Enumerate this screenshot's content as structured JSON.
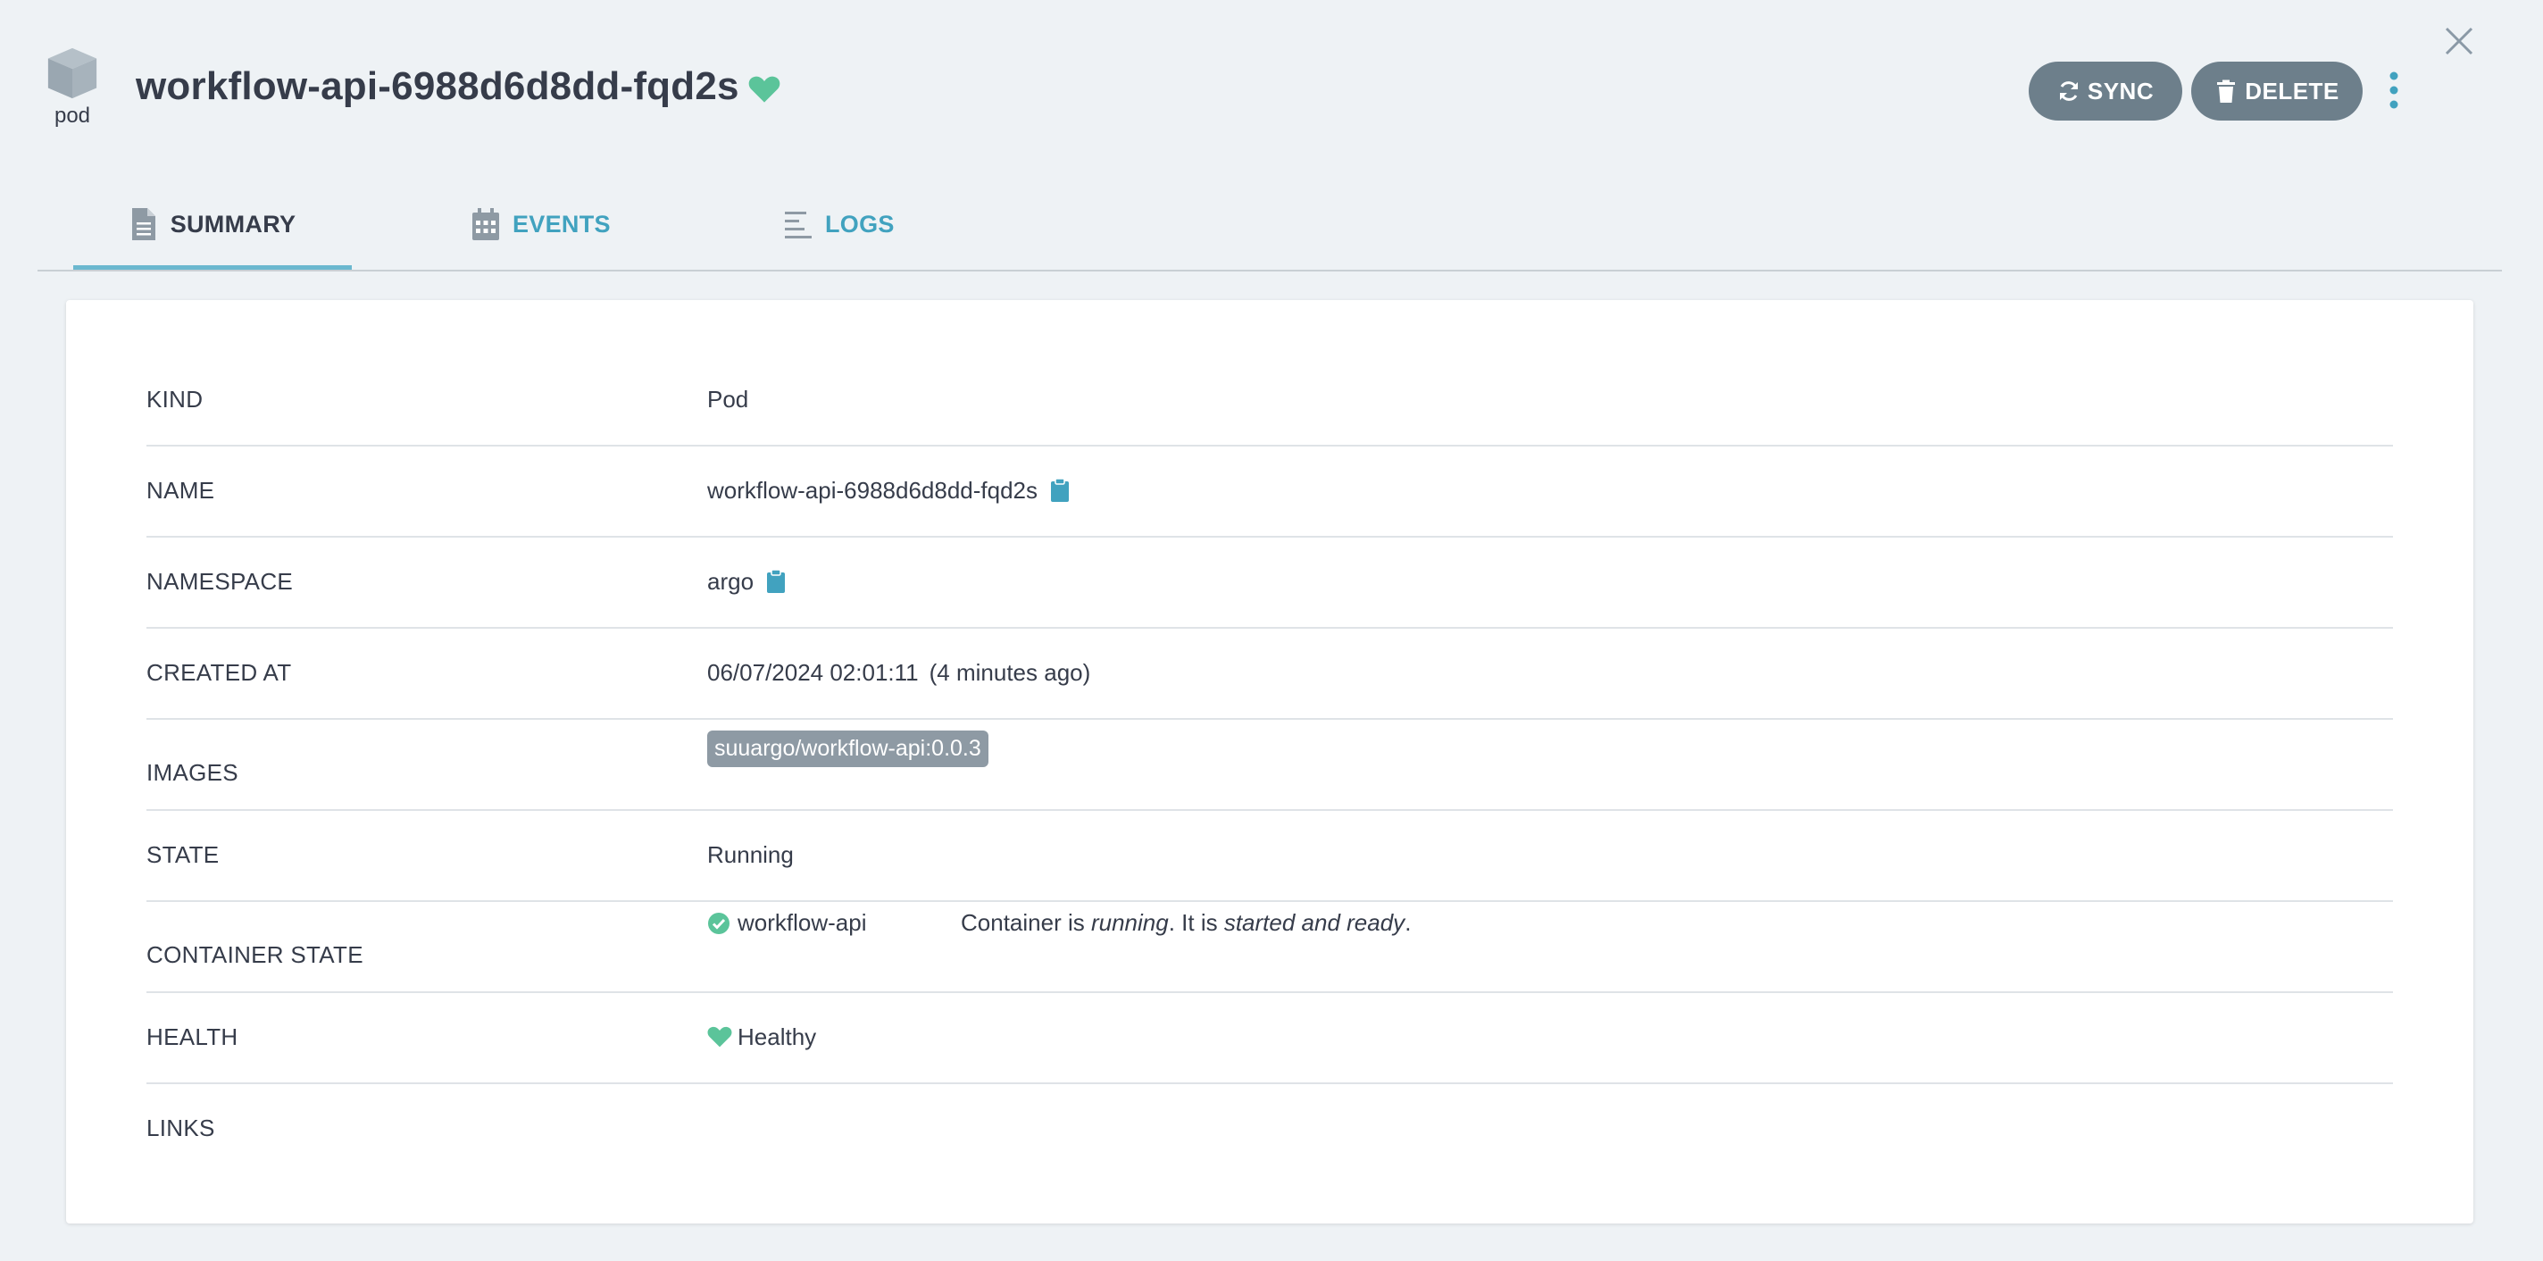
{
  "header": {
    "kind_label": "pod",
    "title": "workflow-api-6988d6d8dd-fqd2s",
    "sync_label": "SYNC",
    "delete_label": "DELETE"
  },
  "tabs": [
    {
      "label": "SUMMARY",
      "active": true
    },
    {
      "label": "EVENTS",
      "active": false
    },
    {
      "label": "LOGS",
      "active": false
    }
  ],
  "summary": {
    "kind": {
      "label": "KIND",
      "value": "Pod"
    },
    "name": {
      "label": "NAME",
      "value": "workflow-api-6988d6d8dd-fqd2s"
    },
    "namespace": {
      "label": "NAMESPACE",
      "value": "argo"
    },
    "created_at": {
      "label": "CREATED AT",
      "value": "06/07/2024 02:01:11",
      "relative": "(4 minutes ago)"
    },
    "images": {
      "label": "IMAGES",
      "value": "suuargo/workflow-api:0.0.3"
    },
    "state": {
      "label": "STATE",
      "value": "Running"
    },
    "container_state": {
      "label": "CONTAINER STATE",
      "container": "workflow-api",
      "text_prefix": "Container is ",
      "text_status": "running",
      "text_mid": ". It is ",
      "text_ready": "started and ready",
      "text_end": "."
    },
    "health": {
      "label": "HEALTH",
      "value": "Healthy"
    },
    "links": {
      "label": "LINKS"
    }
  },
  "colors": {
    "background": "#eef2f5",
    "accent": "#41a2bf",
    "healthy": "#5bc49a",
    "button": "#6d7f8b",
    "chip": "#8e9aa4"
  },
  "icons": [
    "cube-icon",
    "heart-icon",
    "close-icon",
    "sync-icon",
    "trash-icon",
    "kebab-icon",
    "file-icon",
    "calendar-icon",
    "logs-icon",
    "clipboard-icon",
    "check-circle-icon"
  ]
}
